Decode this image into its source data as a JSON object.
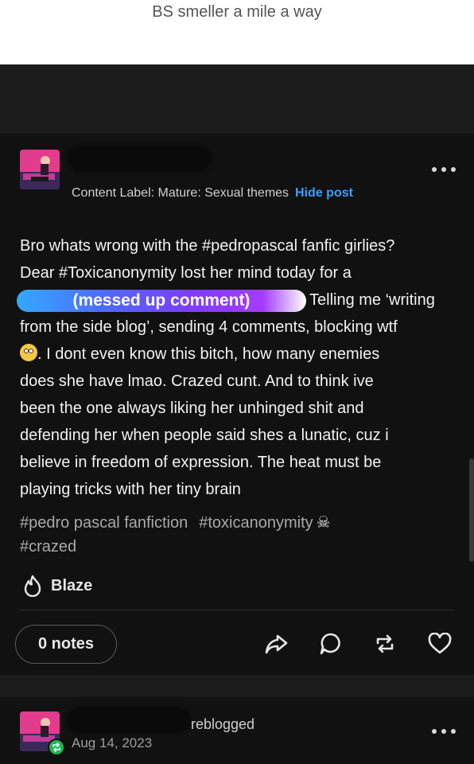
{
  "caption": "BS smeller a mile a way",
  "post": {
    "content_label": "Content Label: Mature: Sexual themes",
    "hide_post": "Hide post",
    "body": {
      "line1": "Bro whats wrong with the #pedropascal fanfic girlies?",
      "line2": "Dear #Toxicanonymity lost her mind today for a",
      "pill": "(messed up comment)",
      "line3_after_pill": "Telling me ‘writing",
      "line4": "from the side blog’, sending 4 comments, blocking wtf",
      "line5_after_emoji": ". I dont even know this bitch, how many enemies",
      "line6": "does she have lmao. Crazed cunt. And to think ive",
      "line7": "been the one always liking her unhinged shit and",
      "line8": "defending her when people said shes a lunatic, cuz i",
      "line9": "believe in freedom of expression. The heat must be",
      "line10": "playing tricks with her tiny brain"
    },
    "tags": [
      "#pedro pascal fanfiction",
      "#toxicanonymity",
      "#crazed"
    ],
    "tag_emoji": "☠",
    "blaze_label": "Blaze",
    "notes_label": "0 notes",
    "icons": [
      "share-icon",
      "comment-icon",
      "reblog-icon",
      "like-icon"
    ]
  },
  "post2": {
    "reblogged_label": "reblogged",
    "date": "Aug 14, 2023"
  },
  "colors": {
    "background": "#111111",
    "link": "#3aa0ff",
    "reblog_green": "#1eb854"
  }
}
